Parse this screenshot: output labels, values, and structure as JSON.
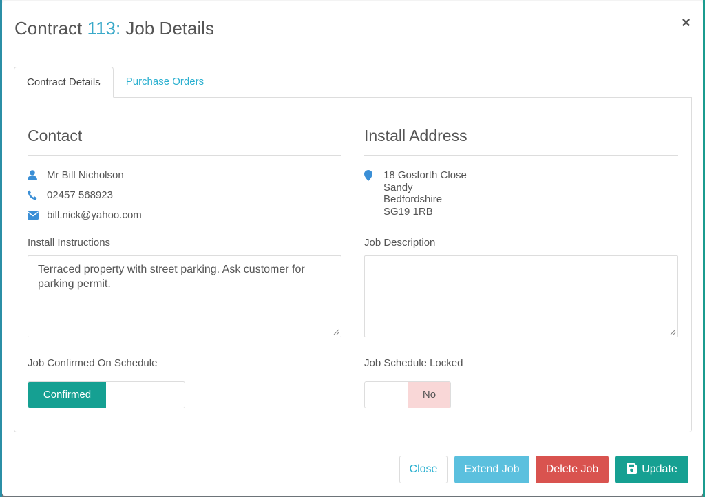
{
  "modal": {
    "title_prefix": "Contract ",
    "contract_number": "113:",
    "title_suffix": " Job Details",
    "close_symbol": "×"
  },
  "tabs": [
    {
      "label": "Contract Details",
      "active": true
    },
    {
      "label": "Purchase Orders",
      "active": false
    }
  ],
  "contact": {
    "heading": "Contact",
    "name": "Mr Bill Nicholson",
    "phone": "02457 568923",
    "email": "bill.nick@yahoo.com",
    "icons": [
      "user-icon",
      "phone-icon",
      "envelope-icon"
    ]
  },
  "install_address": {
    "heading": "Install Address",
    "line1": "18 Gosforth Close",
    "line2": "Sandy",
    "line3": "Bedfordshire",
    "line4": "SG19 1RB",
    "icon": "map-marker-icon"
  },
  "install_instructions": {
    "label": "Install Instructions",
    "value": "Terraced property with street parking. Ask customer for parking permit."
  },
  "job_description": {
    "label": "Job Description",
    "value": ""
  },
  "job_confirmed": {
    "label": "Job Confirmed On Schedule",
    "on_label": "Confirmed",
    "state": "on"
  },
  "job_locked": {
    "label": "Job Schedule Locked",
    "off_label": "No",
    "state": "off"
  },
  "footer": {
    "close_label": "Close",
    "extend_label": "Extend Job",
    "delete_label": "Delete Job",
    "update_label": "Update"
  },
  "colors": {
    "accent": "#3aa9c9",
    "primary_teal": "#16a092",
    "info": "#5bc0de",
    "danger": "#d9534f",
    "icon_blue": "#3b8fd6"
  }
}
